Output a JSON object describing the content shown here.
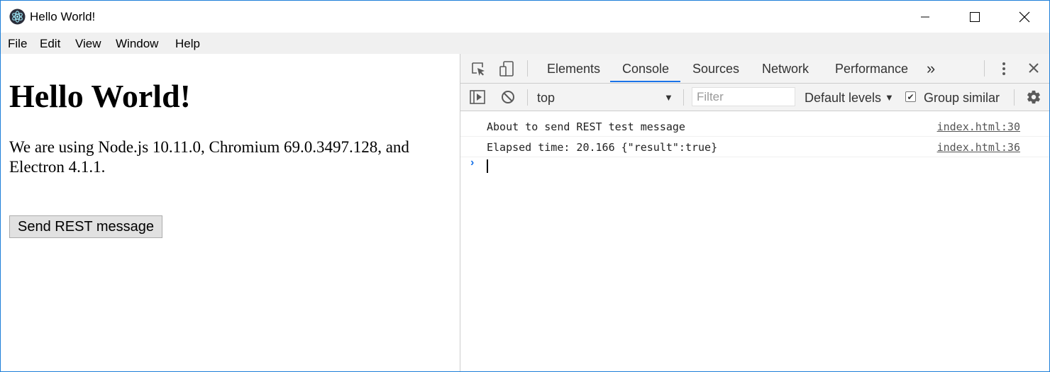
{
  "window": {
    "title": "Hello World!",
    "controls": {
      "minimize": "minimize",
      "maximize": "maximize",
      "close": "close"
    }
  },
  "menu": {
    "items": [
      "File",
      "Edit",
      "View",
      "Window",
      "Help"
    ]
  },
  "page": {
    "heading": "Hello World!",
    "paragraph": "We are using Node.js 10.11.0, Chromium 69.0.3497.128, and Electron 4.1.1.",
    "button": "Send REST message"
  },
  "devtools": {
    "tabs": [
      "Elements",
      "Console",
      "Sources",
      "Network",
      "Performance"
    ],
    "active_tab": "Console",
    "more_tabs": "»",
    "toolbar": {
      "context": "top",
      "filter_placeholder": "Filter",
      "levels": "Default levels",
      "group_similar": "Group similar",
      "group_similar_checked": true
    },
    "console": {
      "messages": [
        {
          "text": "About to send REST test message",
          "source": "index.html:30"
        },
        {
          "text": "Elapsed time: 20.166 {\"result\":true}",
          "source": "index.html:36"
        }
      ],
      "prompt": "›"
    }
  },
  "colors": {
    "window_border": "#1e7fd8",
    "accent": "#1a73e8",
    "toolbar_bg": "#f3f3f3",
    "menubar_bg": "#f0f0f0"
  }
}
